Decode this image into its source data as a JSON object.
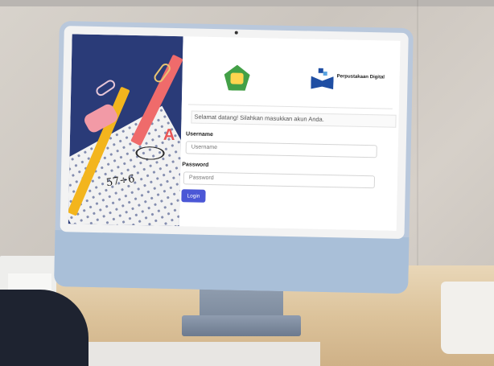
{
  "login": {
    "welcome_message": "Selamat datang! Silahkan masukkan akun Anda.",
    "username_label": "Username",
    "username_placeholder": "Username",
    "password_label": "Password",
    "password_placeholder": "Password",
    "login_button": "Login"
  },
  "logos": {
    "left": "tutwuri-handayani-logo",
    "right_text": "Perpustakaan Digital"
  },
  "illustration": {
    "formula": "57÷6",
    "letter": "A"
  },
  "colors": {
    "panel_navy": "#2a3b78",
    "button_blue": "#4b57d6",
    "monitor_blue": "#b9c8dc"
  }
}
